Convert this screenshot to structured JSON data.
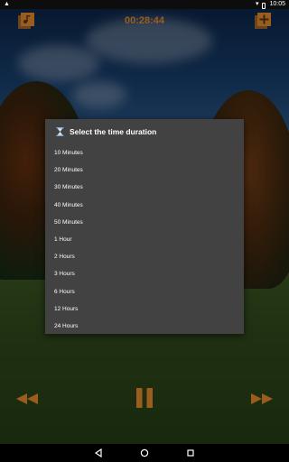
{
  "status_bar": {
    "time": "10:05"
  },
  "timer": {
    "value": "00:28:44"
  },
  "dialog": {
    "title": "Select the time duration",
    "options": [
      "10 Minutes",
      "20 Minutes",
      "30 Minutes",
      "40 Minutes",
      "50 Minutes",
      "1 Hour",
      "2 Hours",
      "3 Hours",
      "6 Hours",
      "12 Hours",
      "24 Hours"
    ]
  },
  "colors": {
    "accent": "#9a5d1e",
    "dialog_bg": "#424242",
    "text": "#ffffff"
  },
  "icons": {
    "music": "music-playlist-icon",
    "add": "add-playlist-icon",
    "rewind": "rewind-icon",
    "pause": "pause-icon",
    "forward": "fast-forward-icon"
  }
}
